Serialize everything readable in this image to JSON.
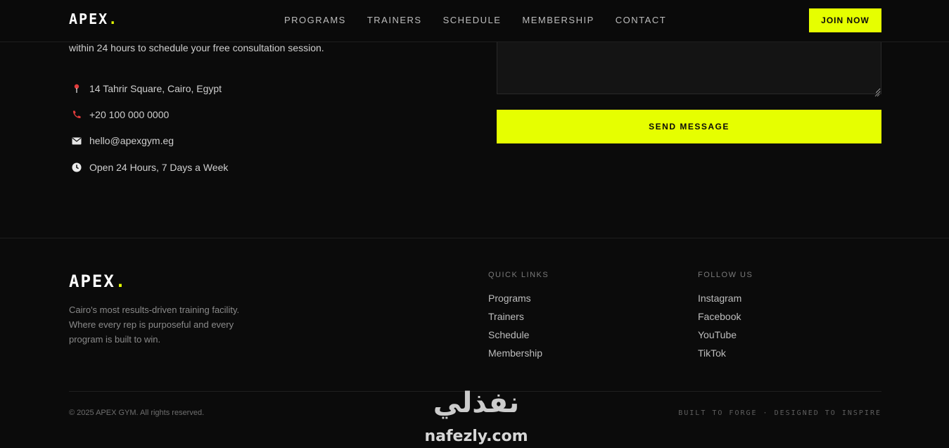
{
  "brand": {
    "name": "APEX",
    "dot": ".",
    "accent": "#e6ff00"
  },
  "nav": {
    "links": [
      "PROGRAMS",
      "TRAINERS",
      "SCHEDULE",
      "MEMBERSHIP",
      "CONTACT"
    ],
    "cta": "JOIN NOW"
  },
  "contact": {
    "intro": "within 24 hours to schedule your free consultation session.",
    "items": [
      {
        "icon": "map-pin-icon",
        "text": "14 Tahrir Square, Cairo, Egypt"
      },
      {
        "icon": "phone-icon",
        "text": "+20 100 000 0000"
      },
      {
        "icon": "mail-icon",
        "text": "hello@apexgym.eg"
      },
      {
        "icon": "clock-icon",
        "text": "Open 24 Hours, 7 Days a Week"
      }
    ],
    "send_label": "SEND MESSAGE"
  },
  "footer": {
    "tagline": "Cairo's most results-driven training facility. Where every rep is purposeful and every program is built to win.",
    "quick_links": {
      "heading": "QUICK LINKS",
      "items": [
        "Programs",
        "Trainers",
        "Schedule",
        "Membership"
      ]
    },
    "follow_us": {
      "heading": "FOLLOW US",
      "items": [
        "Instagram",
        "Facebook",
        "YouTube",
        "TikTok"
      ]
    },
    "copyright": "© 2025 APEX GYM. All rights reserved.",
    "credit": "BUILT TO FORGE · DESIGNED TO INSPIRE"
  },
  "watermark": {
    "arabic": "نفذلي",
    "latin": "nafezly.com"
  }
}
